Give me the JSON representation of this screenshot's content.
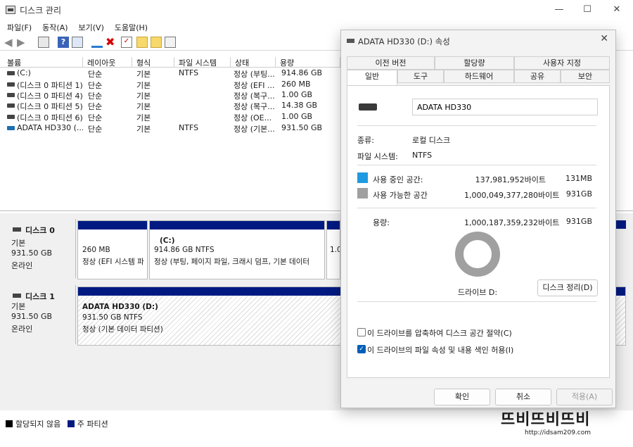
{
  "window": {
    "title": "디스크 관리",
    "controls": [
      "—",
      "☐",
      "✕"
    ]
  },
  "menu": [
    "파일(F)",
    "동작(A)",
    "보기(V)",
    "도움말(H)"
  ],
  "volume_table": {
    "headers": [
      "볼륨",
      "레이아웃",
      "형식",
      "파일 시스템",
      "상태",
      "용량"
    ],
    "rows": [
      {
        "volume": "(C:)",
        "layout": "단순",
        "type": "기본",
        "fs": "NTFS",
        "status": "정상 (부팅...",
        "capacity": "914.86 GB"
      },
      {
        "volume": "(디스크 0 파티션 1)",
        "layout": "단순",
        "type": "기본",
        "fs": "",
        "status": "정상 (EFI ...",
        "capacity": "260 MB"
      },
      {
        "volume": "(디스크 0 파티션 4)",
        "layout": "단순",
        "type": "기본",
        "fs": "",
        "status": "정상 (복구...",
        "capacity": "1.00 GB"
      },
      {
        "volume": "(디스크 0 파티션 5)",
        "layout": "단순",
        "type": "기본",
        "fs": "",
        "status": "정상 (복구...",
        "capacity": "14.38 GB"
      },
      {
        "volume": "(디스크 0 파티션 6)",
        "layout": "단순",
        "type": "기본",
        "fs": "",
        "status": "정상 (OE...",
        "capacity": "1.00 GB"
      },
      {
        "volume": "ADATA HD330 (...",
        "layout": "단순",
        "type": "기본",
        "fs": "NTFS",
        "status": "정상 (기본...",
        "capacity": "931.50 GB"
      }
    ]
  },
  "disks": [
    {
      "name": "디스크 0",
      "type": "기본",
      "size": "931.50 GB",
      "state": "온라인",
      "partitions": [
        {
          "line1": "260 MB",
          "line2": "정상 (EFI 시스템 파"
        },
        {
          "line1": "(C:)",
          "line2": "914.86 GB NTFS",
          "line3": "정상 (부팅, 페이지 파일, 크래시 덤프, 기본 데이터"
        },
        {
          "line1": "1.0"
        }
      ]
    },
    {
      "name": "디스크 1",
      "type": "기본",
      "size": "931.50 GB",
      "state": "온라인",
      "partitions": [
        {
          "line1": "ADATA HD330  (D:)",
          "line2": "931.50 GB NTFS",
          "line3": "정상 (기본 데이터 파티션)"
        }
      ]
    }
  ],
  "legend": {
    "unallocated": "할당되지 않음",
    "primary": "주 파티션"
  },
  "dialog": {
    "title": "ADATA HD330 (D:) 속성",
    "tabs_row1": [
      "이전 버전",
      "할당량",
      "사용자 지정"
    ],
    "tabs_row2": [
      "일반",
      "도구",
      "하드웨어",
      "공유",
      "보안"
    ],
    "drive_name": "ADATA HD330",
    "type_label": "종류:",
    "type_value": "로컬 디스크",
    "fs_label": "파일 시스템:",
    "fs_value": "NTFS",
    "used_label": "사용 중인 공간:",
    "used_bytes": "137,981,952바이트",
    "used_size": "131MB",
    "free_label": "사용 가능한 공간",
    "free_bytes": "1,000,049,377,280바이트",
    "free_size": "931GB",
    "cap_label": "용량:",
    "cap_bytes": "1,000,187,359,232바이트",
    "cap_size": "931GB",
    "drive_label": "드라이브 D:",
    "cleanup_button": "디스크 정리(D)",
    "compress_label": "이 드라이브를 압축하여 디스크 공간 절약(C)",
    "compress_checked": false,
    "index_label": "이 드라이브의 파일 속성 및 내용 색인 허용(I)",
    "index_checked": true,
    "ok": "확인",
    "cancel": "취소",
    "apply": "적용(A)",
    "used_color": "#1f9ae0",
    "free_color": "#a0a0a0",
    "used_fraction": 0.000138
  },
  "watermark": {
    "text": "뜨비뜨비뜨비",
    "url": "http://idsam209.com"
  },
  "colors": {
    "partition_bar": "#001a82",
    "checkbox_accent": "#005fb8"
  }
}
